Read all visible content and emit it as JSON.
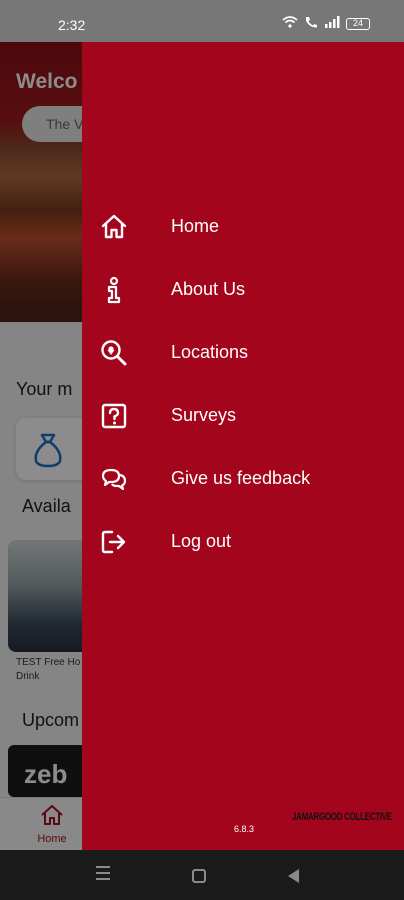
{
  "status_bar": {
    "time": "2:32",
    "battery": "24"
  },
  "background_app": {
    "hero_title": "Welco",
    "hero_pill_text": "The V",
    "wallet_section_title": "Your m",
    "available_section_title": "Availa",
    "offer_caption": "TEST Free Ho Drink",
    "upcoming_section_title": "Upcom",
    "event_card_text": "zeb",
    "bottom_nav_home_label": "Home"
  },
  "drawer": {
    "menu": [
      {
        "label": "Home",
        "icon": "home-icon"
      },
      {
        "label": "About Us",
        "icon": "info-icon"
      },
      {
        "label": "Locations",
        "icon": "location-search-icon"
      },
      {
        "label": "Surveys",
        "icon": "question-icon"
      },
      {
        "label": "Give us feedback",
        "icon": "chat-icon"
      },
      {
        "label": "Log out",
        "icon": "logout-icon"
      }
    ],
    "version": "6.8.3",
    "brand_text": "JAMARGOOD COLLECTIVE"
  },
  "colors": {
    "drawer_bg": "#a3051c",
    "accent": "#a3111c",
    "status_bar": "#777777"
  }
}
